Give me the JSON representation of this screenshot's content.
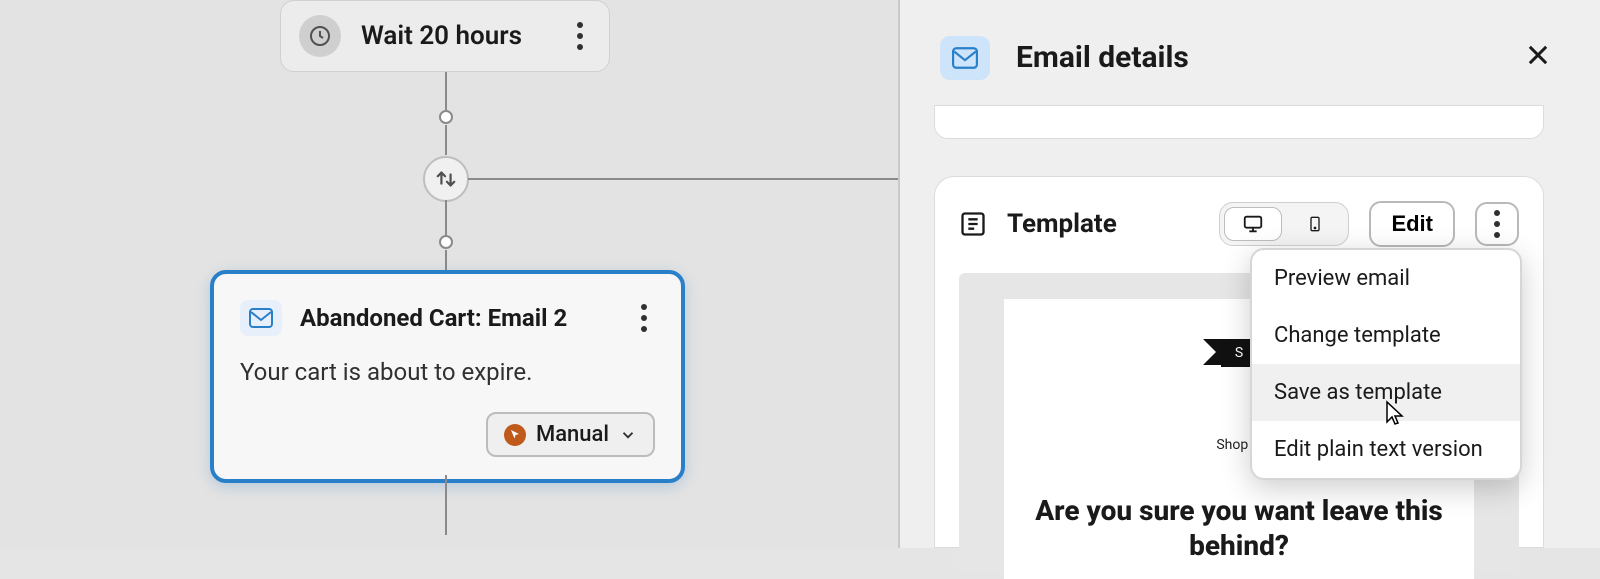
{
  "canvas": {
    "wait_label": "Wait 20 hours",
    "email_title": "Abandoned Cart: Email 2",
    "email_subject": "Your cart is about to expire.",
    "send_mode": "Manual"
  },
  "panel": {
    "title": "Email details",
    "template_section": "Template",
    "edit_button": "Edit",
    "preview_banner_text": "S",
    "preview_shop_link": "Shop N",
    "preview_heading": "Are you sure you want leave this behind?"
  },
  "menu": {
    "items": [
      "Preview email",
      "Change template",
      "Save as template",
      "Edit plain text version"
    ],
    "hover_index": 2
  }
}
